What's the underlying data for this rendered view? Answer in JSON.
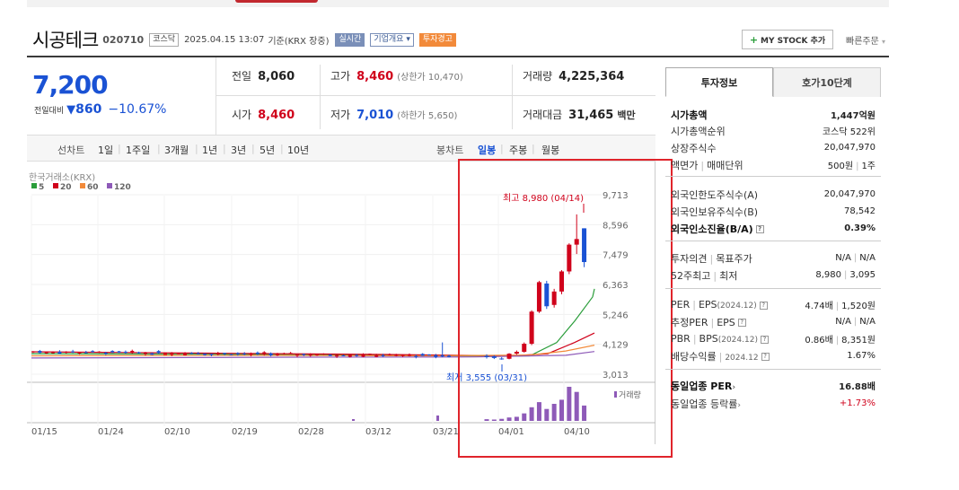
{
  "stock": {
    "name": "시공테크",
    "code": "020710",
    "market": "코스닥",
    "datetime": "2025.04.15 13:07",
    "basis": "기준(KRX 장중)",
    "realtime_label": "실시간",
    "overview_label": "기업개요",
    "warning_label": "투자경고",
    "mystock_label": "MY STOCK 추가",
    "quick_order_label": "빠른주문"
  },
  "quote": {
    "price": "7,200",
    "change_label": "전일대비",
    "change": "860",
    "change_pct": "−10.67%",
    "prev_label": "전일",
    "prev": "8,060",
    "high_label": "고가",
    "high": "8,460",
    "upper_limit": "(상한가 10,470)",
    "volume_label": "거래량",
    "volume": "4,225,364",
    "open_label": "시가",
    "open": "8,460",
    "low_label": "저가",
    "low": "7,010",
    "lower_limit": "(하한가 5,650)",
    "value_label": "거래대금",
    "value": "31,465",
    "value_unit": "백만"
  },
  "periods": {
    "lead": "선차트",
    "items": [
      "1일",
      "1주일",
      "3개월",
      "1년",
      "3년",
      "5년",
      "10년"
    ],
    "candle_lead": "봉차트",
    "candle_items": [
      "일봉",
      "주봉",
      "월봉"
    ],
    "candle_selected": "일봉"
  },
  "chart_data": {
    "type": "candlestick",
    "source_label": "한국거래소(KRX)",
    "ma_legend": [
      {
        "name": "5",
        "color": "#2a9d3a"
      },
      {
        "name": "20",
        "color": "#d0021b"
      },
      {
        "name": "60",
        "color": "#f28a3a"
      },
      {
        "name": "120",
        "color": "#8e5ab8"
      }
    ],
    "y_ticks": [
      "9,713",
      "8,596",
      "7,479",
      "6,363",
      "5,246",
      "4,129",
      "3,013"
    ],
    "ylim": [
      3013,
      9713
    ],
    "x_ticks": [
      "01/15",
      "01/24",
      "02/10",
      "02/19",
      "02/28",
      "03/12",
      "03/21",
      "04/01",
      "04/10"
    ],
    "high_annotation": "최고 8,980 (04/14)",
    "low_annotation": "최저 3,555 (03/31)",
    "volume_label": "거래량",
    "candles_recent": [
      {
        "o": 3700,
        "h": 3760,
        "l": 3600,
        "c": 3650
      },
      {
        "o": 3680,
        "h": 3720,
        "l": 3580,
        "c": 3620
      },
      {
        "o": 3600,
        "h": 3650,
        "l": 3555,
        "c": 3590
      },
      {
        "o": 3590,
        "h": 3800,
        "l": 3570,
        "c": 3780
      },
      {
        "o": 3780,
        "h": 3900,
        "l": 3740,
        "c": 3850
      },
      {
        "o": 3850,
        "h": 4200,
        "l": 3820,
        "c": 4150
      },
      {
        "o": 4150,
        "h": 5400,
        "l": 4100,
        "c": 5350
      },
      {
        "o": 5350,
        "h": 6500,
        "l": 5300,
        "c": 6450
      },
      {
        "o": 6400,
        "h": 6500,
        "l": 5450,
        "c": 5550
      },
      {
        "o": 5600,
        "h": 6200,
        "l": 5500,
        "c": 6100
      },
      {
        "o": 6100,
        "h": 6900,
        "l": 6000,
        "c": 6850
      },
      {
        "o": 6850,
        "h": 7900,
        "l": 6750,
        "c": 7850
      },
      {
        "o": 7850,
        "h": 8980,
        "l": 7500,
        "c": 8060
      },
      {
        "o": 8460,
        "h": 8460,
        "l": 7010,
        "c": 7200
      }
    ],
    "volume_recent": [
      0.05,
      0.04,
      0.06,
      0.1,
      0.12,
      0.22,
      0.4,
      0.55,
      0.35,
      0.5,
      0.62,
      1.0,
      0.85,
      0.45
    ]
  },
  "invest": {
    "tab_on": "투자정보",
    "tab_off": "호가10단계",
    "rows1": [
      {
        "k": "시가총액",
        "v": "1,447억원"
      },
      {
        "k": "시가총액순위",
        "v": "코스닥 522위"
      },
      {
        "k": "상장주식수",
        "v": "20,047,970"
      },
      {
        "k": "액면가",
        "k2": "매매단위",
        "v": "500원",
        "v2": "1주"
      }
    ],
    "rows2": [
      {
        "k": "외국인한도주식수(A)",
        "v": "20,047,970"
      },
      {
        "k": "외국인보유주식수(B)",
        "v": "78,542"
      },
      {
        "k": "외국인소진율(B/A)",
        "v": "0.39%"
      }
    ],
    "rows3": [
      {
        "k": "투자의견",
        "k2": "목표주가",
        "v": "N/A",
        "v2": "N/A"
      },
      {
        "k": "52주최고",
        "k2": "최저",
        "v": "8,980",
        "v2": "3,095"
      }
    ],
    "rows4": [
      {
        "k": "PER",
        "k2": "EPS",
        "k3": "(2024.12)",
        "v": "4.74배",
        "v2": "1,520원"
      },
      {
        "k": "추정PER",
        "k2": "EPS",
        "v": "N/A",
        "v2": "N/A"
      },
      {
        "k": "PBR",
        "k2": "BPS",
        "k3": "(2024.12)",
        "v": "0.86배",
        "v2": "8,351원"
      },
      {
        "k": "배당수익률",
        "k3": "2024.12",
        "v": "1.67%"
      }
    ],
    "rows5": [
      {
        "k": "동일업종 PER",
        "v": "16.88배"
      },
      {
        "k": "동일업종 등락률",
        "v": "+1.73%"
      }
    ]
  }
}
